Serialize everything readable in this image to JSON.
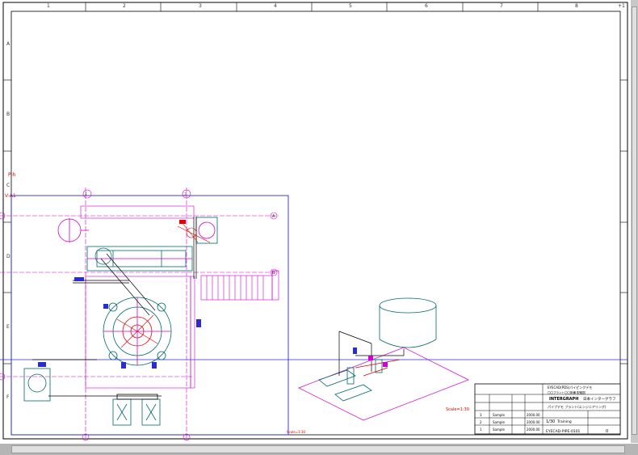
{
  "drawing": {
    "column_labels": [
      "1",
      "2",
      "3",
      "4",
      "5",
      "6",
      "7",
      "8"
    ],
    "row_labels": [
      "A",
      "B",
      "C",
      "D",
      "E",
      "F"
    ],
    "corner_mark": "+1",
    "view_title": "P-h",
    "view_label": "V-A1",
    "scale_label_plan": "Scale=1:30",
    "scale_label_iso": "Scale=1:30",
    "grid_bubbles": [
      "1",
      "2",
      "A",
      "B"
    ]
  },
  "title_block": {
    "company_logo": "INTERGRAPH",
    "company_name": "日本インターグラフ",
    "project_line1": "EYECAD(PDS)パイピングデモ",
    "project_line2": "〇〇プラント〇〇設備 配管図",
    "drawing_title": "パイプデモ プラント(エンジニアリング)",
    "scale_value": "1/30",
    "sheet_name": "Training",
    "drawing_number": "EYECAD-PIPE-0101",
    "revision": "0",
    "revision_rows": [
      {
        "mark": "3",
        "date": "Sample",
        "name": "2000.00"
      },
      {
        "mark": "2",
        "date": "Sample",
        "name": "2000.00"
      },
      {
        "mark": "1",
        "date": "Sample",
        "name": "2000.00"
      }
    ]
  },
  "colors": {
    "frame": "#000000",
    "viewport": "#2b2bd6",
    "grid": "#d000d0",
    "equipment": "#006a6a",
    "piping": "#000000",
    "red_lines": "#e00000",
    "scrollbar": "#c8c8c8"
  }
}
